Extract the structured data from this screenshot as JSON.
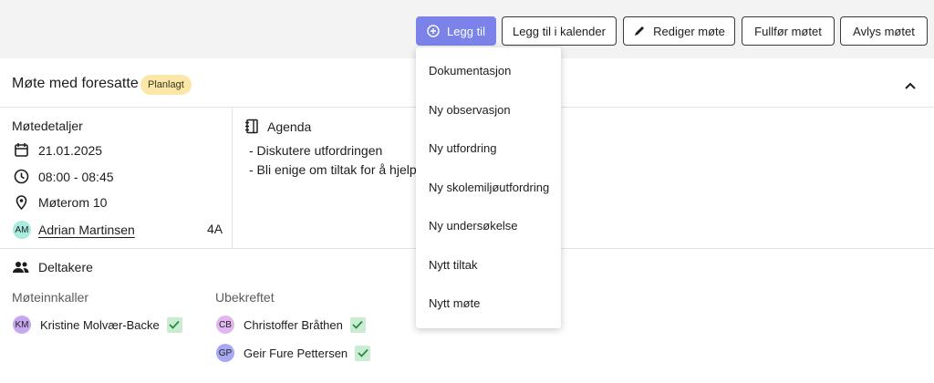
{
  "toolbar": {
    "add_label": "Legg til",
    "calendar_label": "Legg til i kalender",
    "edit_label": "Rediger møte",
    "complete_label": "Fullfør møtet",
    "cancel_label": "Avlys møtet"
  },
  "meeting": {
    "title": "Møte med foresatte",
    "status": "Planlagt"
  },
  "details": {
    "heading": "Møtedetaljer",
    "date": "21.01.2025",
    "time": "08:00 - 08:45",
    "location": "Møterom 10",
    "student_initials": "AM",
    "student_name": "Adrian Martinsen",
    "student_class": "4A"
  },
  "agenda": {
    "heading": "Agenda",
    "items": [
      "- Diskutere utfordringen",
      "- Bli enige om tiltak for å hjelpe A"
    ]
  },
  "participants": {
    "heading": "Deltakere",
    "organizer_label": "Møteinnkaller",
    "unconfirmed_label": "Ubekreftet",
    "organizer": {
      "initials": "KM",
      "name": "Kristine Molvær-Backe"
    },
    "unconfirmed": [
      {
        "initials": "CB",
        "name": "Christoffer Bråthen"
      },
      {
        "initials": "GP",
        "name": "Geir Fure Pettersen"
      }
    ]
  },
  "dropdown": {
    "items": [
      "Dokumentasjon",
      "Ny observasjon",
      "Ny utfordring",
      "Ny skolemiljøutfordring",
      "Ny undersøkelse",
      "Nytt tiltak",
      "Nytt møte"
    ]
  },
  "colors": {
    "primary": "#7b83eb",
    "badge": "#fbe7a8",
    "check": "#c9ecd3",
    "avatar_am": "#a8ece0",
    "avatar_km": "#c7a8f0",
    "avatar_cb": "#e2b6ef",
    "avatar_gp": "#a6a8f2"
  }
}
